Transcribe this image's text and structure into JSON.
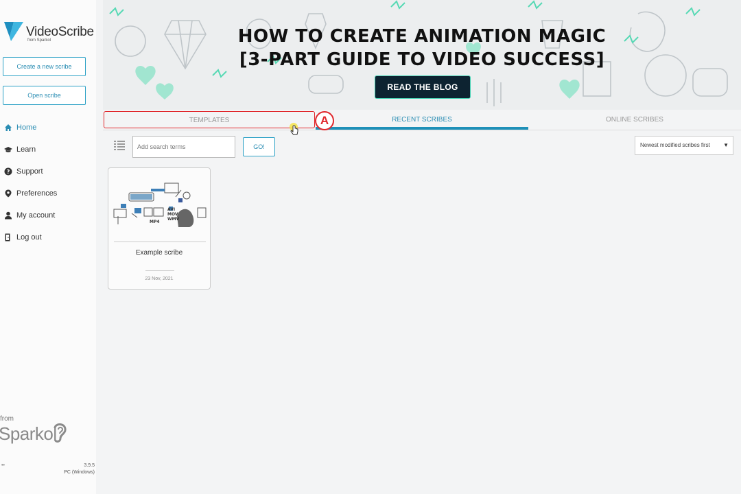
{
  "app": {
    "name": "VideoScribe",
    "sub": "from Sparkol"
  },
  "sidebar": {
    "create_label": "Create a new scribe",
    "open_label": "Open scribe",
    "nav": [
      {
        "label": "Home",
        "icon": "home-icon"
      },
      {
        "label": "Learn",
        "icon": "graduation-cap-icon"
      },
      {
        "label": "Support",
        "icon": "help-icon"
      },
      {
        "label": "Preferences",
        "icon": "location-pin-icon"
      },
      {
        "label": "My account",
        "icon": "user-icon"
      },
      {
        "label": "Log out",
        "icon": "logout-icon"
      }
    ],
    "footer": {
      "from": "from",
      "brand": "Sparkol",
      "version": "3.9.5",
      "platform": "PC (Windows)"
    }
  },
  "banner": {
    "line1": "HOW TO CREATE ANIMATION MAGIC",
    "line2": "[3-PART GUIDE TO VIDEO SUCCESS]",
    "button_label": "READ THE BLOG"
  },
  "tabs": {
    "templates": "TEMPLATES",
    "recent": "RECENT SCRIBES",
    "online": "ONLINE SCRIBES",
    "active": "recent",
    "marker": "A"
  },
  "toolbar": {
    "search_placeholder": "Add search terms",
    "go_label": "GO!",
    "sort_value": "Newest modified scribes first"
  },
  "scribes": [
    {
      "title": "Example scribe",
      "date": "23 Nov, 2021"
    }
  ],
  "colors": {
    "accent": "#2a8db3",
    "highlight": "#e0262b",
    "banner_button": "#0d2331",
    "doodle_green": "#42d2b3"
  }
}
